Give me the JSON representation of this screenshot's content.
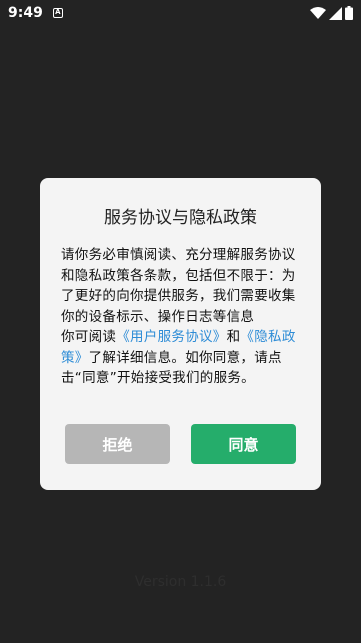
{
  "status_bar": {
    "time": "9:49",
    "notification_glyph": "A",
    "icons": [
      "wifi-icon",
      "signal-icon",
      "battery-icon"
    ]
  },
  "dialog": {
    "title": "服务协议与隐私政策",
    "body_text": "请你务必审慎阅读、充分理解服务协议和隐私政策各条款，包括但不限于：为了更好的向你提供服务，我们需要收集你的设备标示、操作日志等信息",
    "read_prefix": "你可阅读",
    "user_agreement_link": "《用户服务协议》",
    "and_text": "和",
    "privacy_policy_link": "《隐私政策》",
    "read_suffix": "了解详细信息。如你同意，请点击“同意”开始接受我们的服务。",
    "reject_label": "拒绝",
    "agree_label": "同意"
  },
  "version_text": "Version 1.1.6",
  "colors": {
    "background": "#232323",
    "dialog_background": "#f4f4f4",
    "link": "#2d8cd6",
    "reject_button": "#b6b6b6",
    "agree_button": "#25ad6b"
  }
}
